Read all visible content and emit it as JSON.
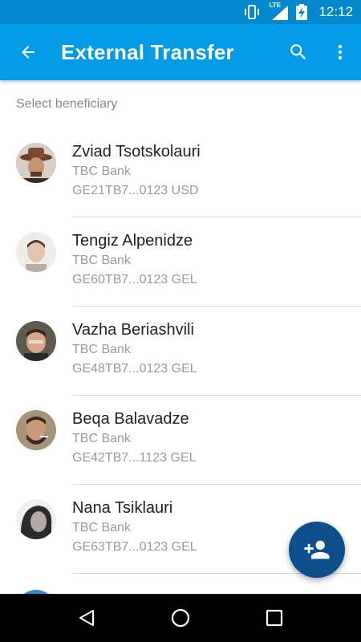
{
  "status_bar": {
    "time": "12:12",
    "network": "LTE",
    "icons": [
      "vibrate-icon",
      "signal-icon",
      "battery-charging-icon"
    ]
  },
  "app_bar": {
    "title": "External Transfer",
    "back_icon": "arrow-back-icon",
    "actions": [
      "search-icon",
      "more-vert-icon"
    ]
  },
  "section_label": "Select beneficiary",
  "beneficiaries": [
    {
      "name": "Zviad Tsotskolauri",
      "bank": "TBC Bank",
      "iban": "GE21TB7...0123 USD",
      "avatar_color": "#5a3a2a"
    },
    {
      "name": "Tengiz Alpenidze",
      "bank": "TBC Bank",
      "iban": "GE60TB7...0123 GEL",
      "avatar_color": "#e6dcd4"
    },
    {
      "name": "Vazha Beriashvili",
      "bank": "TBC Bank",
      "iban": "GE48TB7...0123 GEL",
      "avatar_color": "#6d6a5a"
    },
    {
      "name": "Beqa Balavadze",
      "bank": "TBC Bank",
      "iban": "GE42TB7...1123 GEL",
      "avatar_color": "#9c8a6a"
    },
    {
      "name": "Nana Tsiklauri",
      "bank": "TBC Bank",
      "iban": "GE63TB7...0123 GEL",
      "avatar_color": "#555555"
    }
  ],
  "fab": {
    "icon": "person-add-icon"
  },
  "nav_bar": {
    "icons": [
      "back-triangle-icon",
      "home-circle-icon",
      "recents-square-icon"
    ]
  },
  "colors": {
    "status_bar": "#0288cc",
    "app_bar": "#039be5",
    "fab": "#0d4f8b",
    "secondary_text": "#9a9a9a"
  }
}
